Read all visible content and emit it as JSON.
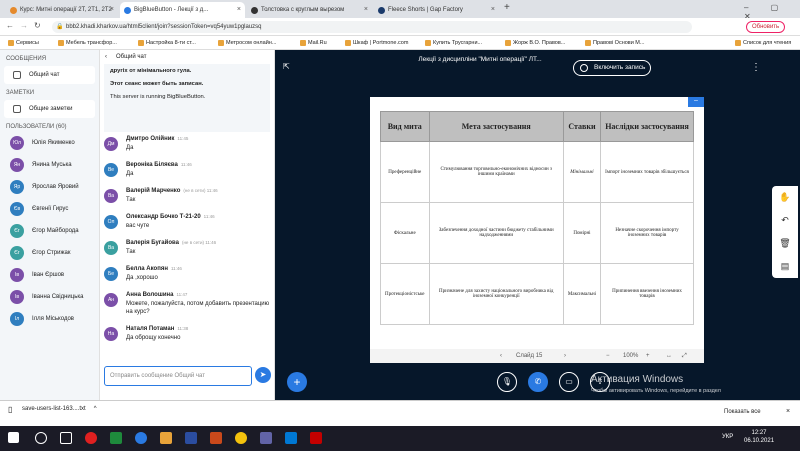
{
  "browser": {
    "tabs": [
      {
        "label": "Курс: Митні операції 2Т, 2Т1, 2Т2",
        "color": "#e58a2c"
      },
      {
        "label": "BigBlueButton - Лекції з д...",
        "color": "#2a7ae2"
      },
      {
        "label": "Толстовка с круглым вырезом",
        "color": "#333333"
      },
      {
        "label": "Fleece Shorts | Gap Factory",
        "color": "#1a3a6b"
      }
    ],
    "url": "bbb2.khadi.kharkov.ua/html5client/join?sessionToken=vq54yuw1pglauzsq",
    "update_button": "Обновить",
    "bookmarks": [
      "Сервисы",
      "Мебель трансфор...",
      "Настройка 8-ти ст...",
      "Метросом онлайн...",
      "Mail.Ru",
      "Шкаф | Portmone.com",
      "Купить Трусгарни...",
      "Жорж В.О. Правов...",
      "Правові Основи М..."
    ],
    "reading_list": "Список для чтения"
  },
  "users_panel": {
    "messages_header": "СООБЩЕНИЯ",
    "public_chat": "Общий чат",
    "notes_header": "ЗАМЕТКИ",
    "shared_notes": "Общие заметки",
    "users_header": "ПОЛЬЗОВАТЕЛИ (60)",
    "users": [
      {
        "initials": "Юл",
        "name": "Юлія Якименко",
        "color": "#7b4fa8"
      },
      {
        "initials": "Ян",
        "name": "Янина Муська",
        "color": "#7b4fa8"
      },
      {
        "initials": "Яр",
        "name": "Ярослав Яровий",
        "color": "#2f7ebf"
      },
      {
        "initials": "Єв",
        "name": "Євгенії Гирус",
        "color": "#2f7ebf"
      },
      {
        "initials": "Єг",
        "name": "Єгор Майборода",
        "color": "#3aa0a0"
      },
      {
        "initials": "Єг",
        "name": "Єгор Стрижак",
        "color": "#3aa0a0"
      },
      {
        "initials": "Ів",
        "name": "Іван Єршов",
        "color": "#7b4fa8"
      },
      {
        "initials": "Ів",
        "name": "Іванна Свідницька",
        "color": "#7b4fa8"
      },
      {
        "initials": "Іл",
        "name": "Ілля Міськодов",
        "color": "#2f7ebf"
      }
    ]
  },
  "chat": {
    "title": "Общий чат",
    "welcome_line1": "другіх от мінімального гула.",
    "welcome_line2": "Этот сеанс может быть записан.",
    "welcome_line3": "This server is running BigBlueButton.",
    "messages": [
      {
        "initials": "Дм",
        "name": "Дмитро Олійник",
        "time": "11:45",
        "text": "Да",
        "color": "#7b4fa8"
      },
      {
        "initials": "Ве",
        "name": "Вероніка Біляєва",
        "time": "11:46",
        "text": "Да",
        "color": "#2f7ebf"
      },
      {
        "initials": "Ва",
        "name": "Валерій Марченко",
        "time": "(не в сети) 11:46",
        "text": "Так",
        "color": "#7b4fa8"
      },
      {
        "initials": "Ол",
        "name": "Олександр Бочко Т-21-20",
        "time": "11:46",
        "text": "вас чуте",
        "color": "#2f7ebf"
      },
      {
        "initials": "Ва",
        "name": "Валерія Бугайова",
        "time": "(не в сети) 11:46",
        "text": "Так",
        "color": "#3aa0a0"
      },
      {
        "initials": "Бе",
        "name": "Белла Акопян",
        "time": "11:46",
        "text": "Да ,хорошо",
        "color": "#2f7ebf"
      },
      {
        "initials": "Ан",
        "name": "Анна Волошина",
        "time": "11:47",
        "text": "Можете, пожалуйста, потом добавить презентацию на курс?",
        "color": "#7b4fa8"
      },
      {
        "initials": "На",
        "name": "Наталя Потаман",
        "time": "11:38",
        "text": "Да оброщу конечно",
        "color": "#7b4fa8"
      }
    ],
    "input_placeholder": "Отправить сообщение Общий чат"
  },
  "presentation": {
    "meeting_title": "Лекції з дисципліни \"Митні операції\" ЛТ...",
    "record_label": "Включить запись",
    "table": {
      "headers": [
        "Вид мита",
        "Мета застосування",
        "Ставки",
        "Наслідки застосування"
      ],
      "rows": [
        [
          "Преференційне",
          "Стимулювання торговельно-економічних відносин з іншими країнами",
          "Мінімальні",
          "Імпорт іноземних товарів збільшується"
        ],
        [
          "Фіскальне",
          "Забезпечення доходної частини бюджету стабільними надходженнями",
          "Помірні",
          "Незначне скорочення імпорту іноземних товарів"
        ],
        [
          "Протекціоністське",
          "Призначене для захисту національного виробника від іноземної конкуренції",
          "Максимальні",
          "Припинення ввезення іноземних товарів"
        ]
      ]
    },
    "slide_label": "Слайд 15",
    "zoom": "100%",
    "watermark_title": "Активация Windows",
    "watermark_sub": "Чтобы активировать Windows, перейдите в раздел"
  },
  "downloads": {
    "file": "save-users-list-163....txt",
    "show_all": "Показать все"
  },
  "taskbar": {
    "lang": "УКР",
    "time": "12:27",
    "date": "06.10.2021"
  }
}
